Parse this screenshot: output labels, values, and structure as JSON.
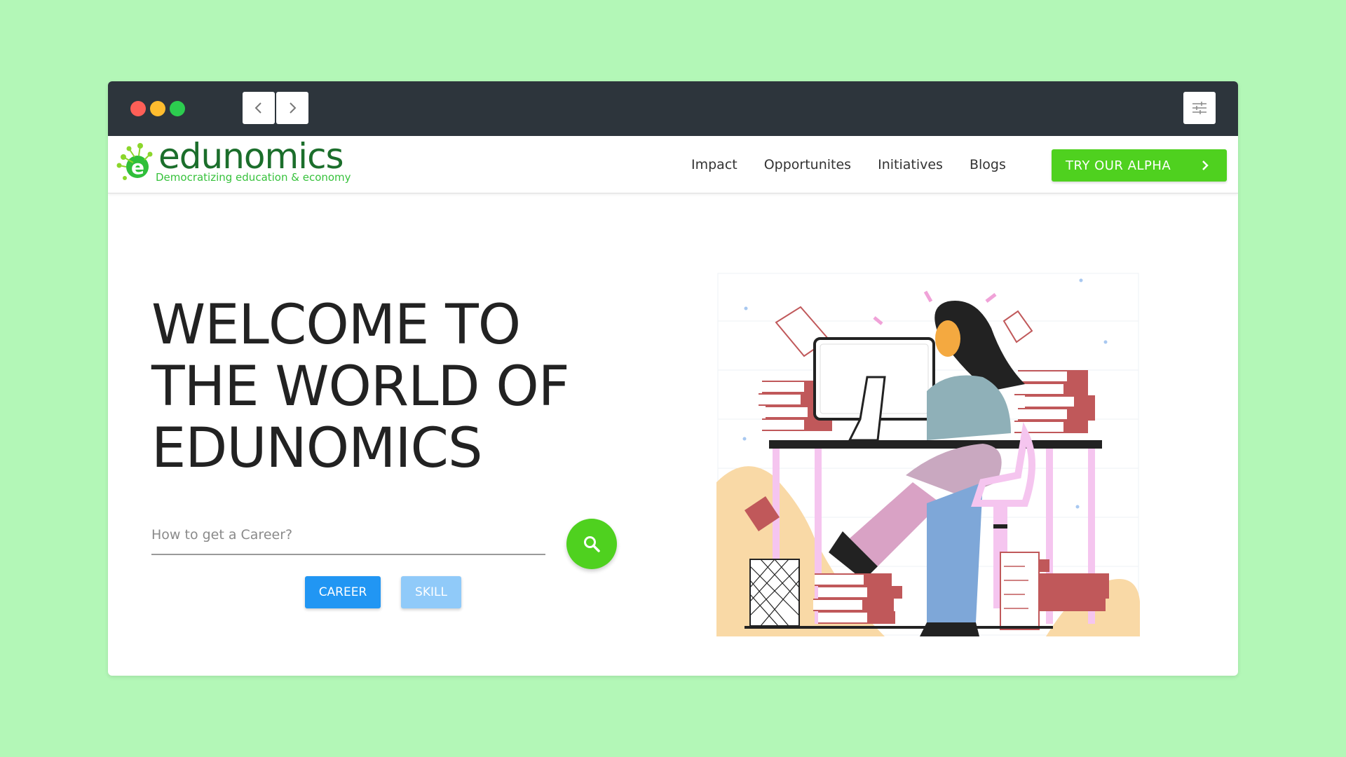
{
  "site": {
    "logo_word": "edunomics",
    "logo_tagline": "Democratizing education & economy"
  },
  "nav": {
    "items": [
      "Impact",
      "Opportunites",
      "Initiatives",
      "Blogs"
    ],
    "cta_label": "TRY OUR ALPHA"
  },
  "hero": {
    "title_lines": [
      "WELCOME TO",
      "THE WORLD OF",
      "EDUNOMICS"
    ],
    "search_placeholder": "How to get a Career?",
    "career_label": "CAREER",
    "skill_label": "SKILL"
  },
  "colors": {
    "background": "#b3f7b7",
    "titlebar": "#2d353c",
    "brand_green": "#4fd11f",
    "logo_dark_green": "#1b6e2b",
    "career_blue": "#2196f3",
    "skill_blue_light": "#90caf9"
  },
  "icons": {
    "back": "chevron-left-icon",
    "forward": "chevron-right-icon",
    "settings": "sliders-icon",
    "search": "search-icon",
    "cta_arrow": "chevron-right-icon"
  }
}
